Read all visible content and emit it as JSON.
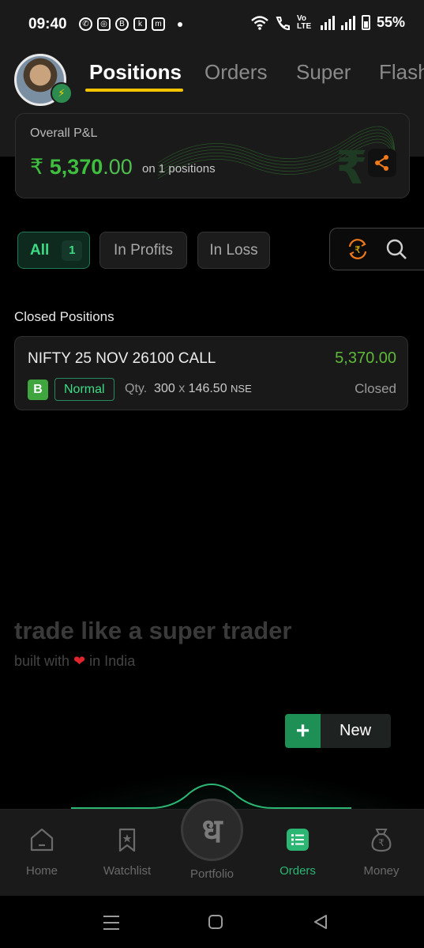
{
  "status_bar": {
    "time": "09:40",
    "network": "Vo LTE",
    "battery": "55%"
  },
  "header": {
    "tabs": [
      {
        "label": "Positions",
        "active": true
      },
      {
        "label": "Orders",
        "active": false
      },
      {
        "label": "Super",
        "active": false
      },
      {
        "label": "Flash",
        "active": false
      }
    ]
  },
  "pnl": {
    "label": "Overall P&L",
    "currency": "₹",
    "value_int": "5,370",
    "value_dec": ".00",
    "subtext": "on 1 positions"
  },
  "filters": {
    "all_label": "All",
    "all_count": "1",
    "profits_label": "In Profits",
    "loss_label": "In Loss"
  },
  "closed_positions": {
    "title": "Closed Positions",
    "items": [
      {
        "name": "NIFTY 25 NOV 26100 CALL",
        "pnl": "5,370.00",
        "side": "B",
        "product": "Normal",
        "qty_label": "Qty.",
        "qty": "300",
        "times": "x",
        "price": "146.50",
        "exchange": "NSE",
        "status": "Closed"
      }
    ]
  },
  "tagline": {
    "title": "trade like a super trader",
    "sub_before": "built with",
    "sub_after": "in India"
  },
  "new_button": {
    "label": "New"
  },
  "bottom_nav": {
    "items": [
      {
        "label": "Home",
        "icon": "home-icon"
      },
      {
        "label": "Watchlist",
        "icon": "bookmark-icon"
      },
      {
        "label": "Portfolio",
        "icon": "portfolio-icon"
      },
      {
        "label": "Orders",
        "icon": "orders-icon",
        "active": true
      },
      {
        "label": "Money",
        "icon": "money-bag-icon"
      }
    ],
    "fab_glyph": "ध"
  },
  "colors": {
    "accent": "#f5c400",
    "profit": "#3fbf3f",
    "brand_green": "#2bb673"
  }
}
